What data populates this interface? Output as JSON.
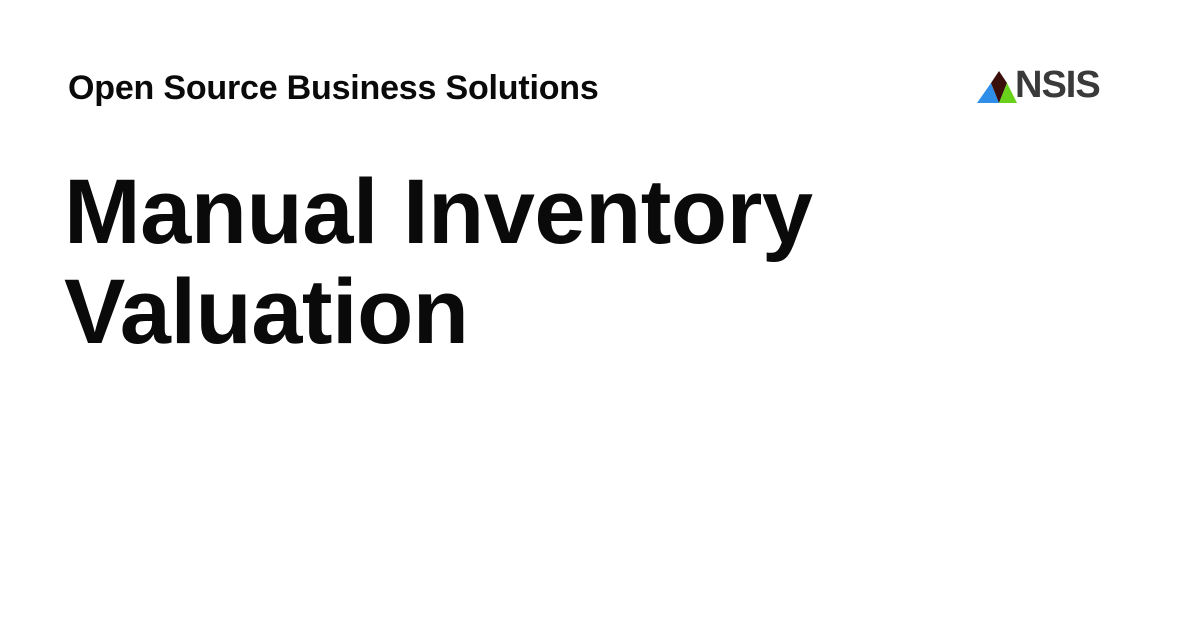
{
  "header": {
    "site_name": "Open Source Business Solutions"
  },
  "logo": {
    "icon": "nsis-mountain-logo-icon",
    "text": "NSIS",
    "colors": {
      "peak": "#3a0f0a",
      "left": "#2e8ee8",
      "right": "#6ad11a",
      "text": "#3a3a3a"
    }
  },
  "main": {
    "headline": "Manual Inventory Valuation"
  }
}
